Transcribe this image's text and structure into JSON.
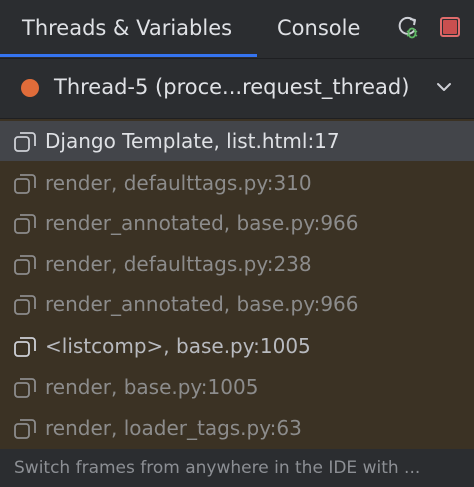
{
  "tabs": [
    {
      "label": "Threads & Variables",
      "active": true
    },
    {
      "label": "Console",
      "active": false
    }
  ],
  "toolbar": {
    "rerun_icon": "rerun-debug-icon",
    "stop_icon": "stop-icon",
    "rerun_color": "#5fb865",
    "stop_color": "#e06c6c"
  },
  "thread": {
    "label": "Thread-5 (proce...request_thread)",
    "status_color": "#e06c3a"
  },
  "frames": [
    {
      "label": "Django Template, list.html:17",
      "selected": true
    },
    {
      "label": "render, defaulttags.py:310",
      "selected": false
    },
    {
      "label": "render_annotated, base.py:966",
      "selected": false
    },
    {
      "label": "render, defaulttags.py:238",
      "selected": false
    },
    {
      "label": "render_annotated, base.py:966",
      "selected": false
    },
    {
      "label": "<listcomp>, base.py:1005",
      "selected": false
    },
    {
      "label": "render, base.py:1005",
      "selected": false
    },
    {
      "label": "render, loader_tags.py:63",
      "selected": false
    }
  ],
  "footer": {
    "text": "Switch frames from anywhere in the IDE with ..."
  },
  "colors": {
    "accent": "#3574f0",
    "frames_background": "#3b3224",
    "selected_row": "#43454a"
  }
}
